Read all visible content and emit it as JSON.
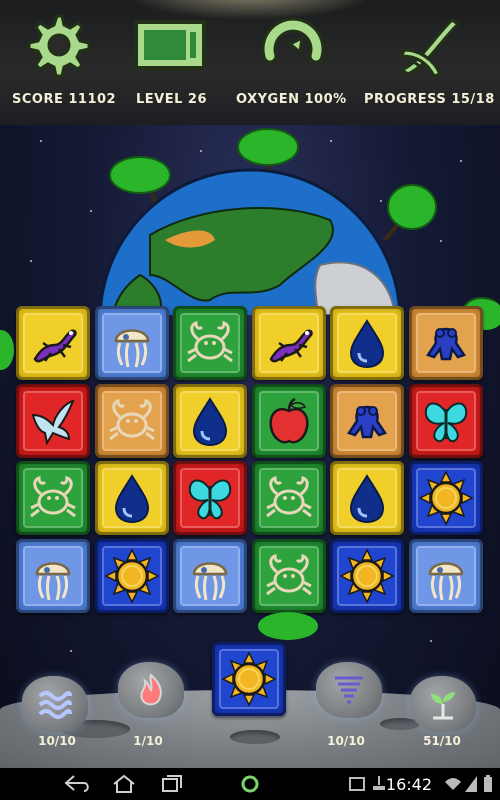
{
  "toolbar": {
    "settings_icon": "gear-icon",
    "battery_icon": "battery-icon",
    "undo_icon": "refresh-icon",
    "dna_icon": "dna-icon"
  },
  "stats": {
    "score": "SCORE 11102",
    "level": "LEVEL 26",
    "oxygen": "OXYGEN 100%",
    "progress": "PROGRESS 15/18"
  },
  "board": {
    "rows": [
      [
        {
          "color": "yellow",
          "icon": "lizard"
        },
        {
          "color": "blue",
          "icon": "jellyfish"
        },
        {
          "color": "green",
          "icon": "crab"
        },
        {
          "color": "yellow",
          "icon": "lizard"
        },
        {
          "color": "yellow",
          "icon": "water-drop"
        },
        {
          "color": "orange",
          "icon": "frog"
        }
      ],
      [
        {
          "color": "red",
          "icon": "bird"
        },
        {
          "color": "orange",
          "icon": "crab"
        },
        {
          "color": "yellow",
          "icon": "water-drop"
        },
        {
          "color": "green",
          "icon": "apple"
        },
        {
          "color": "orange",
          "icon": "frog"
        },
        {
          "color": "red",
          "icon": "butterfly"
        }
      ],
      [
        {
          "color": "green",
          "icon": "crab"
        },
        {
          "color": "yellow",
          "icon": "water-drop"
        },
        {
          "color": "red",
          "icon": "butterfly"
        },
        {
          "color": "green",
          "icon": "crab"
        },
        {
          "color": "yellow",
          "icon": "water-drop"
        },
        {
          "color": "navy",
          "icon": "sun"
        }
      ],
      [
        {
          "color": "blue",
          "icon": "jellyfish"
        },
        {
          "color": "navy",
          "icon": "sun"
        },
        {
          "color": "blue",
          "icon": "jellyfish"
        },
        {
          "color": "green",
          "icon": "crab"
        },
        {
          "color": "navy",
          "icon": "sun"
        },
        {
          "color": "blue",
          "icon": "jellyfish"
        }
      ]
    ],
    "next_tile": {
      "color": "navy",
      "icon": "sun"
    }
  },
  "powerups": [
    {
      "icon": "wave-icon",
      "count": "10/10"
    },
    {
      "icon": "fire-icon",
      "count": "1/10"
    },
    {
      "icon": "tornado-icon",
      "count": "10/10"
    },
    {
      "icon": "sprout-icon",
      "count": "51/10"
    }
  ],
  "statusbar": {
    "time": "16:42"
  },
  "colors": {
    "yellow": "#f1cf2a",
    "blue": "#6f97e6",
    "green": "#2ea23c",
    "red": "#e02626",
    "orange": "#e3a24e",
    "navy": "#2046cf",
    "icon_outline": "#b7e08a"
  }
}
